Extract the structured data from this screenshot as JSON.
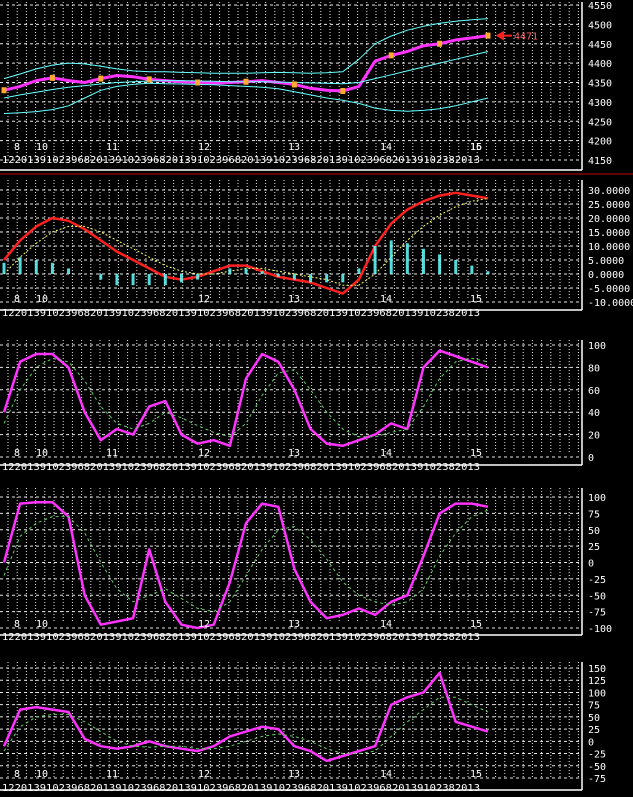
{
  "colors": {
    "bg": "#000000",
    "grid": "#ffffff",
    "frame": "#ffffff",
    "divider": "#c00000",
    "magenta": "#ff33ff",
    "cyan": "#66ffff",
    "red": "#ff2020",
    "orange": "#ffaa33",
    "green": "#66cc66",
    "yellow": "#ffff66"
  },
  "hour_labels": [
    "12",
    "20",
    "13",
    "9",
    "10",
    "2",
    "3",
    "9",
    "6",
    "8",
    "20",
    "13",
    "9",
    "10",
    "2",
    "3",
    "9",
    "6",
    "8",
    "20",
    "13",
    "9",
    "10",
    "2",
    "3",
    "9",
    "6",
    "8",
    "20",
    "13",
    "9",
    "10",
    "2",
    "3",
    "9",
    "6",
    "8",
    "20",
    "13",
    "9",
    "10",
    "2",
    "3",
    "9",
    "6",
    "8",
    "20",
    "13",
    "9",
    "10",
    "2",
    "3",
    "8",
    "20",
    "13"
  ],
  "chart_data": [
    {
      "type": "line",
      "panel": "price",
      "ylim": [
        4150,
        4550
      ],
      "yticks": [
        "4150",
        "4200",
        "4250",
        "4300",
        "4350",
        "4400",
        "4450",
        "4500",
        "4550"
      ],
      "day_labels": [
        "8",
        "10",
        "11",
        "12",
        "13",
        "14",
        "15",
        "16"
      ],
      "last_price_label": "4471",
      "series": [
        {
          "values": [
            4330,
            4340,
            4355,
            4362,
            4355,
            4350,
            4360,
            4368,
            4365,
            4358,
            4355,
            4352,
            4350,
            4348,
            4350,
            4352,
            4355,
            4350,
            4345,
            4335,
            4330,
            4328,
            4340,
            4405,
            4420,
            4430,
            4445,
            4450,
            4460,
            4465,
            4471
          ]
        },
        {
          "values": [
            4310,
            4318,
            4325,
            4332,
            4338,
            4342,
            4346,
            4350,
            4352,
            4354,
            4355,
            4355,
            4354,
            4353,
            4352,
            4352,
            4352,
            4351,
            4350,
            4349,
            4348,
            4347,
            4350,
            4360,
            4370,
            4380,
            4390,
            4400,
            4410,
            4420,
            4430
          ]
        },
        {
          "values": [
            4360,
            4372,
            4385,
            4395,
            4400,
            4398,
            4392,
            4385,
            4380,
            4378,
            4378,
            4376,
            4375,
            4374,
            4374,
            4374,
            4375,
            4376,
            4375,
            4374,
            4375,
            4378,
            4410,
            4450,
            4470,
            4485,
            4495,
            4503,
            4508,
            4512,
            4515
          ]
        },
        {
          "values": [
            4270,
            4272,
            4275,
            4280,
            4290,
            4310,
            4330,
            4340,
            4345,
            4348,
            4347,
            4346,
            4345,
            4344,
            4342,
            4340,
            4338,
            4334,
            4326,
            4318,
            4310,
            4304,
            4296,
            4284,
            4278,
            4276,
            4278,
            4282,
            4290,
            4300,
            4310
          ]
        }
      ]
    },
    {
      "type": "line",
      "panel": "macd",
      "ylim": [
        -10,
        30
      ],
      "yticks": [
        "-10.0000",
        "-5.0000",
        "0.0000",
        "5.0000",
        "10.0000",
        "15.0000",
        "20.0000",
        "25.0000",
        "30.0000"
      ],
      "day_labels": [
        "8",
        "10",
        "12",
        "13",
        "14",
        "15"
      ],
      "series": [
        {
          "values": [
            5,
            12,
            17,
            20,
            19,
            16,
            12,
            8,
            5,
            2,
            -1,
            -2,
            -1,
            1,
            3,
            3,
            1,
            -1,
            -2,
            -3,
            -5,
            -7,
            -2,
            10,
            18,
            23,
            26,
            28,
            29,
            28,
            27
          ]
        },
        {
          "values": [
            0,
            6,
            11,
            15,
            17,
            17,
            15,
            12,
            9,
            6,
            3,
            1,
            0,
            0,
            1,
            2,
            2,
            1,
            0,
            -1,
            -2,
            -4,
            -4,
            0,
            6,
            12,
            17,
            21,
            24,
            26,
            27
          ]
        },
        {
          "values": [
            4,
            6,
            5,
            4,
            2,
            0,
            -2,
            -4,
            -4,
            -4,
            -4,
            -3,
            -2,
            0,
            2,
            2,
            1,
            -1,
            -2,
            -3,
            -3,
            -3,
            2,
            10,
            12,
            11,
            9,
            7,
            5,
            3,
            1
          ]
        }
      ]
    },
    {
      "type": "line",
      "panel": "oscillator_a",
      "ylim": [
        0,
        100
      ],
      "yticks": [
        "0",
        "20",
        "40",
        "60",
        "80",
        "100"
      ],
      "day_labels": [
        "8",
        "10",
        "11",
        "12",
        "13",
        "14",
        "15"
      ],
      "series": [
        {
          "values": [
            40,
            85,
            92,
            92,
            80,
            40,
            15,
            25,
            20,
            45,
            50,
            20,
            12,
            15,
            10,
            70,
            92,
            85,
            60,
            25,
            12,
            10,
            15,
            20,
            30,
            25,
            80,
            95,
            90,
            85,
            80
          ]
        },
        {
          "values": [
            30,
            60,
            80,
            88,
            85,
            68,
            45,
            30,
            25,
            30,
            40,
            35,
            28,
            22,
            18,
            30,
            55,
            75,
            78,
            60,
            40,
            25,
            18,
            18,
            22,
            25,
            45,
            70,
            85,
            88,
            85
          ]
        }
      ]
    },
    {
      "type": "line",
      "panel": "oscillator_b",
      "ylim": [
        -100,
        100
      ],
      "yticks": [
        "-100",
        "-75",
        "-50",
        "-25",
        "0",
        "25",
        "50",
        "75",
        "100"
      ],
      "day_labels": [
        "8",
        "10",
        "12",
        "13",
        "14",
        "15"
      ],
      "series": [
        {
          "values": [
            0,
            90,
            92,
            92,
            70,
            -50,
            -95,
            -90,
            -85,
            20,
            -60,
            -95,
            -100,
            -95,
            -30,
            60,
            90,
            85,
            -10,
            -60,
            -85,
            -80,
            -70,
            -80,
            -60,
            -50,
            10,
            75,
            90,
            90,
            85
          ]
        },
        {
          "values": [
            -20,
            40,
            60,
            70,
            70,
            45,
            0,
            -40,
            -60,
            -50,
            -40,
            -55,
            -70,
            -75,
            -60,
            -20,
            20,
            50,
            55,
            35,
            5,
            -30,
            -50,
            -60,
            -65,
            -60,
            -40,
            10,
            45,
            70,
            80
          ]
        }
      ]
    },
    {
      "type": "line",
      "panel": "oscillator_c",
      "ylim": [
        -75,
        150
      ],
      "yticks": [
        "-75",
        "-50",
        "-25",
        "0",
        "25",
        "50",
        "75",
        "100",
        "125",
        "150"
      ],
      "day_labels": [
        "8",
        "10",
        "11",
        "12",
        "13",
        "14",
        "15"
      ],
      "series": [
        {
          "values": [
            -10,
            65,
            70,
            65,
            60,
            5,
            -10,
            -15,
            -10,
            0,
            -10,
            -15,
            -20,
            -10,
            10,
            20,
            30,
            25,
            -10,
            -20,
            -40,
            -30,
            -20,
            -10,
            75,
            90,
            100,
            140,
            40,
            30,
            20
          ]
        },
        {
          "values": [
            -20,
            30,
            50,
            55,
            55,
            40,
            20,
            0,
            -10,
            -12,
            -10,
            -10,
            -15,
            -15,
            -10,
            0,
            10,
            15,
            10,
            0,
            -15,
            -25,
            -25,
            -20,
            10,
            40,
            65,
            90,
            90,
            75,
            60
          ]
        }
      ]
    }
  ]
}
